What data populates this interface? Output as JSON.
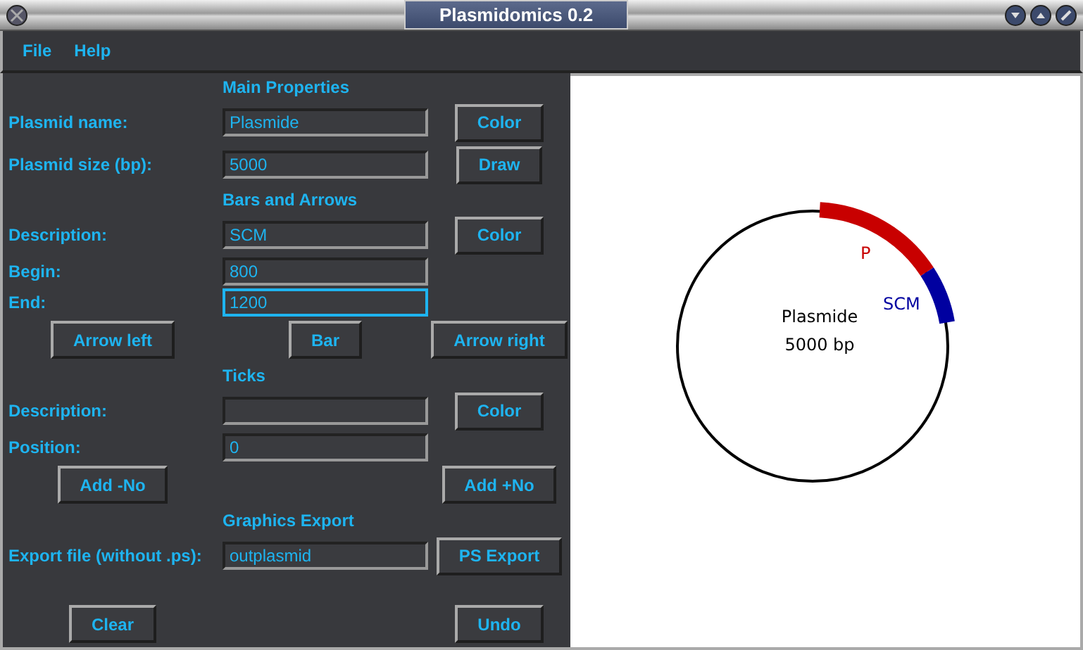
{
  "window": {
    "title": "Plasmidomics 0.2"
  },
  "menu": [
    {
      "label": "File"
    },
    {
      "label": "Help"
    }
  ],
  "sections": [
    {
      "heading": "Main Properties",
      "rows": [
        {
          "kind": "field",
          "label": "Plasmid name:",
          "value": "Plasmide",
          "focused": false,
          "button": "Color"
        },
        {
          "kind": "field",
          "label": "Plasmid size (bp):",
          "value": "5000",
          "focused": false,
          "button": "Draw"
        }
      ]
    },
    {
      "heading": "Bars and Arrows",
      "rows": [
        {
          "kind": "field",
          "label": "Description:",
          "value": "SCM",
          "focused": false,
          "button": "Color"
        },
        {
          "kind": "field",
          "label": "Begin:",
          "value": "800",
          "focused": false
        },
        {
          "kind": "field",
          "label": "End:",
          "value": "1200",
          "focused": true
        },
        {
          "kind": "buttons",
          "buttons": [
            "Arrow left",
            "Bar",
            "Arrow right"
          ]
        }
      ]
    },
    {
      "heading": "Ticks",
      "rows": [
        {
          "kind": "field",
          "label": "Description:",
          "value": "",
          "focused": false,
          "button": "Color"
        },
        {
          "kind": "field",
          "label": "Position:",
          "value": "0",
          "focused": false
        },
        {
          "kind": "buttons",
          "buttons": [
            "Add -No",
            "Add +No"
          ]
        }
      ]
    },
    {
      "heading": "Graphics Export",
      "rows": [
        {
          "kind": "field",
          "label": "Export file (without .ps):",
          "value": "outplasmid",
          "focused": false,
          "button": "PS Export"
        },
        {
          "kind": "spacer"
        },
        {
          "kind": "buttons",
          "buttons": [
            "Clear",
            "Undo"
          ]
        }
      ]
    }
  ],
  "map": {
    "name": "Plasmide",
    "size": "5000 bp",
    "features": [
      {
        "label": "P",
        "color": "#c80000"
      },
      {
        "label": "SCM",
        "color": "#0000a0"
      }
    ]
  }
}
